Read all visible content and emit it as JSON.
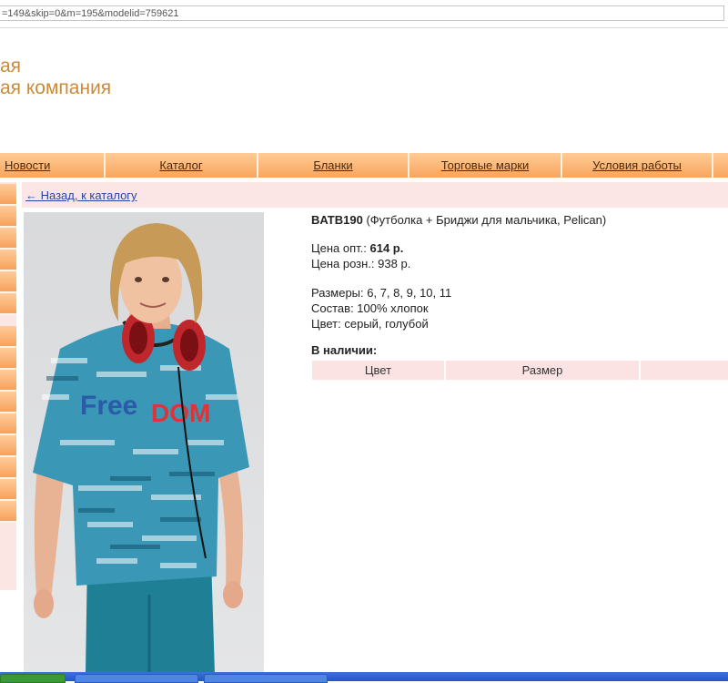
{
  "browser": {
    "url": "=149&skip=0&m=195&modelid=759621"
  },
  "header": {
    "logo_line1": "ая",
    "logo_line2": "ая компания"
  },
  "nav": {
    "items": [
      {
        "label": "Новости"
      },
      {
        "label": "Каталог"
      },
      {
        "label": "Бланки"
      },
      {
        "label": "Торговые марки"
      },
      {
        "label": "Условия работы"
      }
    ]
  },
  "back_link": "← Назад, к каталогу",
  "product": {
    "code": "BATB190",
    "description": "(Футболка + Бриджи для мальчика, Pelican)",
    "price_wholesale_label": "Цена опт.:",
    "price_wholesale_value": "614 р.",
    "price_retail": "Цена розн.: 938 р.",
    "sizes": "Размеры: 6, 7, 8, 9, 10, 11",
    "composition": "Состав: 100% хлопок",
    "color": "Цвет: серый, голубой",
    "photo_print_text": "FreeDOM"
  },
  "availability": {
    "heading": "В наличии:",
    "columns": [
      "Цвет",
      "Размер"
    ]
  }
}
